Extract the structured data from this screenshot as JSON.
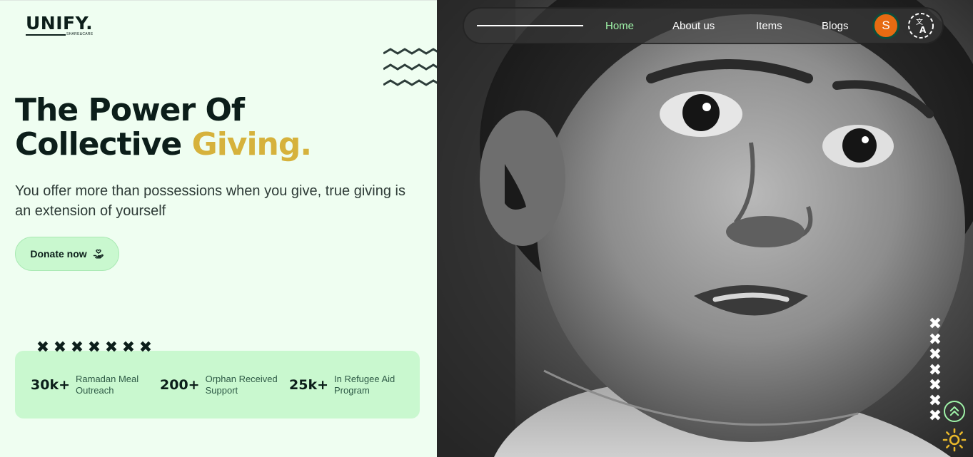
{
  "brand": {
    "name": "UNIFY.",
    "tagline": "SHARE&CARE"
  },
  "hero": {
    "headline_line1": "The Power Of",
    "headline_line2_prefix": "Collective ",
    "headline_accent": "Giving.",
    "subtext": "You offer more than possessions when you give, true giving is an extension of yourself",
    "donate_label": "Donate now",
    "donate_icon": "hand-heart-icon"
  },
  "stats": [
    {
      "value": "30k+",
      "label": "Ramadan Meal Outreach"
    },
    {
      "value": "200+",
      "label": "Orphan Received Support"
    },
    {
      "value": "25k+",
      "label": "In Refugee Aid Program"
    }
  ],
  "nav": {
    "links": [
      "Home",
      "About us",
      "Items",
      "Blogs"
    ],
    "active": "Home",
    "avatar_letter": "S",
    "language_icon": "translate-icon"
  },
  "decor": {
    "x_mark": "✖"
  },
  "colors": {
    "background": "#effef1",
    "stats_bg": "#c9f8cf",
    "accent_gold": "#d6b23c",
    "dark": "#0c1e1a",
    "nav_active": "#9ff3a8",
    "avatar": "#e66b12",
    "sun": "#e8b72a"
  },
  "controls": {
    "scroll_top_icon": "double-chevron-up-icon",
    "theme_icon": "sun-icon"
  }
}
